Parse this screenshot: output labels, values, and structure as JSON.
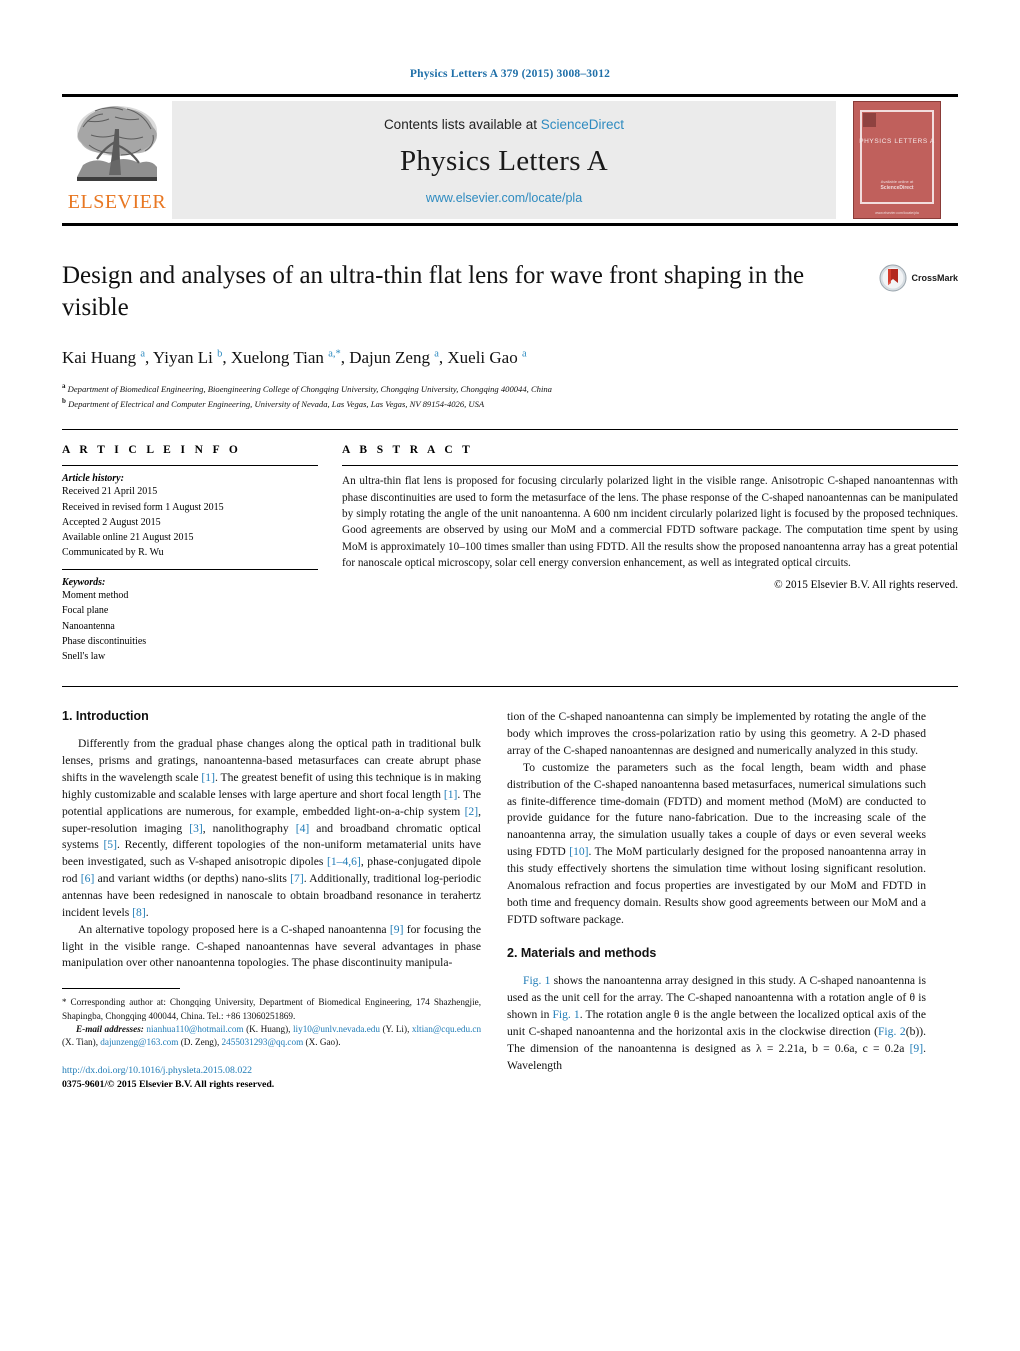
{
  "running_head": "Physics Letters A 379 (2015) 3008–3012",
  "masthead": {
    "contents_prefix": "Contents lists available at ",
    "contents_link": "ScienceDirect",
    "journal_title": "Physics Letters A",
    "journal_url": "www.elsevier.com/locate/pla",
    "publisher_word": "ELSEVIER",
    "cover": {
      "title": "PHYSICS LETTERS A",
      "footer_line1": "Available online at",
      "footer_line2": "ScienceDirect",
      "bottom_line": "www.elsevier.com/locate/pla"
    }
  },
  "article": {
    "title": "Design and analyses of an ultra-thin flat lens for wave front shaping in the visible",
    "crossmark_label": "CrossMark",
    "authors_html": "Kai Huang <sup>a</sup>, Yiyan Li <sup>b</sup>, Xuelong Tian <sup>a,*</sup>, Dajun Zeng <sup>a</sup>, Xueli Gao <sup>a</sup>",
    "affiliation_a": "Department of Biomedical Engineering, Bioengineering College of Chongqing University, Chongqing University, Chongqing 400044, China",
    "affiliation_b": "Department of Electrical and Computer Engineering, University of Nevada, Las Vegas, Las Vegas, NV 89154-4026, USA"
  },
  "article_info": {
    "heading": "A R T I C L E  I N F O",
    "history_label": "Article history:",
    "history": [
      "Received 21 April 2015",
      "Received in revised form 1 August 2015",
      "Accepted 2 August 2015",
      "Available online 21 August 2015",
      "Communicated by R. Wu"
    ],
    "keywords_label": "Keywords:",
    "keywords": [
      "Moment method",
      "Focal plane",
      "Nanoantenna",
      "Phase discontinuities",
      "Snell's law"
    ]
  },
  "abstract": {
    "heading": "A B S T R A C T",
    "text": "An ultra-thin flat lens is proposed for focusing circularly polarized light in the visible range. Anisotropic C-shaped nanoantennas with phase discontinuities are used to form the metasurface of the lens. The phase response of the C-shaped nanoantennas can be manipulated by simply rotating the angle of the unit nanoantenna. A 600 nm incident circularly polarized light is focused by the proposed techniques. Good agreements are observed by using our MoM and a commercial FDTD software package. The computation time spent by using MoM is approximately 10–100 times smaller than using FDTD. All the results show the proposed nanoantenna array has a great potential for nanoscale optical microscopy, solar cell energy conversion enhancement, as well as integrated optical circuits.",
    "copyright": "© 2015 Elsevier B.V. All rights reserved."
  },
  "body": {
    "section1_heading": "1. Introduction",
    "section2_heading": "2. Materials and methods",
    "left_paragraphs": [
      "Differently from the gradual phase changes along the optical path in traditional bulk lenses, prisms and gratings, nanoantenna-based metasurfaces can create abrupt phase shifts in the wavelength scale [1]. The greatest benefit of using this technique is in making highly customizable and scalable lenses with large aperture and short focal length [1]. The potential applications are numerous, for example, embedded light-on-a-chip system [2], super-resolution imaging [3], nanolithography [4] and broadband chromatic optical systems [5]. Recently, different topologies of the non-uniform metamaterial units have been investigated, such as V-shaped anisotropic dipoles [1–4,6], phase-conjugated dipole rod [6] and variant widths (or depths) nano-slits [7]. Additionally, traditional log-periodic antennas have been redesigned in nanoscale to obtain broadband resonance in terahertz incident levels [8].",
      "An alternative topology proposed here is a C-shaped nanoantenna [9] for focusing the light in the visible range. C-shaped nanoantennas have several advantages in phase manipulation over other nanoantenna topologies. The phase discontinuity manipula-"
    ],
    "right_paragraphs": [
      "tion of the C-shaped nanoantenna can simply be implemented by rotating the angle of the body which improves the cross-polarization ratio by using this geometry. A 2-D phased array of the C-shaped nanoantennas are designed and numerically analyzed in this study.",
      "To customize the parameters such as the focal length, beam width and phase distribution of the C-shaped nanoantenna based metasurfaces, numerical simulations such as finite-difference time-domain (FDTD) and moment method (MoM) are conducted to provide guidance for the future nano-fabrication. Due to the increasing scale of the nanoantenna array, the simulation usually takes a couple of days or even several weeks using FDTD [10]. The MoM particularly designed for the proposed nanoantenna array in this study effectively shortens the simulation time without losing significant resolution. Anomalous refraction and focus properties are investigated by our MoM and FDTD in both time and frequency domain. Results show good agreements between our MoM and a FDTD software package.",
      "Fig. 1 shows the nanoantenna array designed in this study. A C-shaped nanoantenna is used as the unit cell for the array. The C-shaped nanoantenna with a rotation angle of θ is shown in Fig. 1. The rotation angle θ is the angle between the localized optical axis of the unit C-shaped nanoantenna and the horizontal axis in the clockwise direction (Fig. 2(b)). The dimension of the nanoantenna is designed as λ = 2.21a, b = 0.6a, c = 0.2a [9]. Wavelength"
    ]
  },
  "footnotes": {
    "corresponding": "Corresponding author at: Chongqing University, Department of Biomedical Engineering, 174 Shazhengjie, Shapingba, Chongqing 400044, China. Tel.: +86 13060251869.",
    "email_label": "E-mail addresses:",
    "emails": [
      {
        "addr": "nianhua110@hotmail.com",
        "who": "(K. Huang)"
      },
      {
        "addr": "liy10@unlv.nevada.edu",
        "who": "(Y. Li)"
      },
      {
        "addr": "xltian@cqu.edu.cn",
        "who": "(X. Tian)"
      },
      {
        "addr": "dajunzeng@163.com",
        "who": "(D. Zeng)"
      },
      {
        "addr": "2455031293@qq.com",
        "who": "(X. Gao)"
      }
    ],
    "doi_url": "http://dx.doi.org/10.1016/j.physleta.2015.08.022",
    "issn_line": "0375-9601/© 2015 Elsevier B.V. All rights reserved."
  },
  "colors": {
    "link": "#1f7bb6",
    "elsevier_orange": "#E87722",
    "cover_red": "#c0605c",
    "band_grey": "#ebebeb"
  }
}
